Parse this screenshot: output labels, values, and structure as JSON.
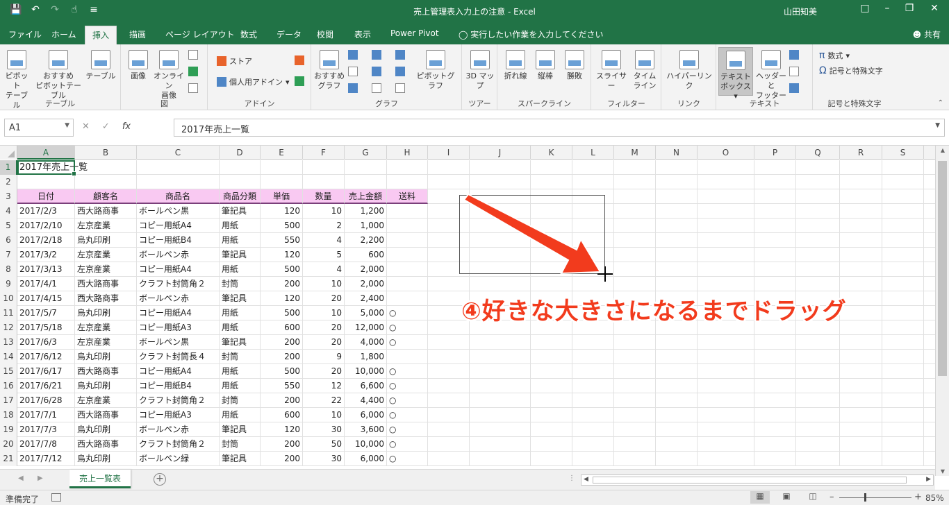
{
  "titlebar": {
    "doc_title": "売上管理表入力上の注意 - Excel",
    "user": "山田知美",
    "qat_icons": [
      "save-icon",
      "undo-icon",
      "redo-icon",
      "touch-mode-icon",
      "customize-icon"
    ]
  },
  "tabs": {
    "items": [
      "ファイル",
      "ホーム",
      "挿入",
      "描画",
      "ページ レイアウト",
      "数式",
      "データ",
      "校閲",
      "表示",
      "Power Pivot"
    ],
    "active": "挿入",
    "tell_me": "実行したい作業を入力してください",
    "share": "共有"
  },
  "ribbon": {
    "table_group": {
      "label": "テーブル",
      "pivot": "ピボット\nテーブル",
      "recommended_pivot": "おすすめ\nピボットテーブル",
      "table": "テーブル"
    },
    "illust_group": {
      "label": "図",
      "picture": "画像",
      "online_picture": "オンライン\n画像"
    },
    "addin_group": {
      "label": "アドイン",
      "store": "ストア",
      "my_addins": "個人用アドイン"
    },
    "chart_group": {
      "label": "グラフ",
      "recommended_chart": "おすすめ\nグラフ",
      "pivot_chart": "ピボットグラフ"
    },
    "tour_group": {
      "label": "ツアー",
      "map3d": "3D マッ\nプ"
    },
    "spark_group": {
      "label": "スパークライン",
      "line": "折れ線",
      "column": "縦棒",
      "winloss": "勝敗"
    },
    "filter_group": {
      "label": "フィルター",
      "slicer": "スライサー",
      "timeline": "タイム\nライン"
    },
    "link_group": {
      "label": "リンク",
      "hyperlink": "ハイパーリンク"
    },
    "text_group": {
      "label": "テキスト",
      "textbox": "テキスト\nボックス",
      "header_footer": "ヘッダーと\nフッター"
    },
    "symbol_group": {
      "label": "記号と特殊文字",
      "equation": "数式",
      "symbol": "記号と特殊文字"
    }
  },
  "formula_bar": {
    "name_box": "A1",
    "fx": "fx",
    "content": "2017年売上一覧"
  },
  "grid": {
    "columns": [
      "A",
      "B",
      "C",
      "D",
      "E",
      "F",
      "G",
      "H",
      "I",
      "J",
      "K",
      "L",
      "M",
      "N",
      "O",
      "P",
      "Q",
      "R",
      "S"
    ],
    "row_numbers": [
      "1",
      "2",
      "3",
      "4",
      "5",
      "6",
      "7",
      "8",
      "9",
      "10",
      "11",
      "12",
      "13",
      "14",
      "15",
      "16",
      "17",
      "18",
      "19",
      "20",
      "21"
    ],
    "title_cell": "2017年売上一覧",
    "headers": [
      "日付",
      "顧客名",
      "商品名",
      "商品分類",
      "単価",
      "数量",
      "売上金額",
      "送料"
    ],
    "rows": [
      [
        "2017/2/3",
        "西大路商事",
        "ボールペン黒",
        "筆記具",
        "120",
        "10",
        "1,200",
        ""
      ],
      [
        "2017/2/10",
        "左京産業",
        "コピー用紙A4",
        "用紙",
        "500",
        "2",
        "1,000",
        ""
      ],
      [
        "2017/2/18",
        "烏丸印刷",
        "コピー用紙B4",
        "用紙",
        "550",
        "4",
        "2,200",
        ""
      ],
      [
        "2017/3/2",
        "左京産業",
        "ボールペン赤",
        "筆記具",
        "120",
        "5",
        "600",
        ""
      ],
      [
        "2017/3/13",
        "左京産業",
        "コピー用紙A4",
        "用紙",
        "500",
        "4",
        "2,000",
        ""
      ],
      [
        "2017/4/1",
        "西大路商事",
        "クラフト封筒角２",
        "封筒",
        "200",
        "10",
        "2,000",
        ""
      ],
      [
        "2017/4/15",
        "西大路商事",
        "ボールペン赤",
        "筆記具",
        "120",
        "20",
        "2,400",
        ""
      ],
      [
        "2017/5/7",
        "烏丸印刷",
        "コピー用紙A4",
        "用紙",
        "500",
        "10",
        "5,000",
        "○"
      ],
      [
        "2017/5/18",
        "左京産業",
        "コピー用紙A3",
        "用紙",
        "600",
        "20",
        "12,000",
        "○"
      ],
      [
        "2017/6/3",
        "左京産業",
        "ボールペン黒",
        "筆記具",
        "200",
        "20",
        "4,000",
        "○"
      ],
      [
        "2017/6/12",
        "烏丸印刷",
        "クラフト封筒長４",
        "封筒",
        "200",
        "9",
        "1,800",
        ""
      ],
      [
        "2017/6/17",
        "西大路商事",
        "コピー用紙A4",
        "用紙",
        "500",
        "20",
        "10,000",
        "○"
      ],
      [
        "2017/6/21",
        "烏丸印刷",
        "コピー用紙B4",
        "用紙",
        "550",
        "12",
        "6,600",
        "○"
      ],
      [
        "2017/6/28",
        "左京産業",
        "クラフト封筒角２",
        "封筒",
        "200",
        "22",
        "4,400",
        "○"
      ],
      [
        "2017/7/1",
        "西大路商事",
        "コピー用紙A3",
        "用紙",
        "600",
        "10",
        "6,000",
        "○"
      ],
      [
        "2017/7/3",
        "烏丸印刷",
        "ボールペン赤",
        "筆記具",
        "120",
        "30",
        "3,600",
        "○"
      ],
      [
        "2017/7/8",
        "西大路商事",
        "クラフト封筒角２",
        "封筒",
        "200",
        "50",
        "10,000",
        "○"
      ],
      [
        "2017/7/12",
        "烏丸印刷",
        "ボールペン緑",
        "筆記具",
        "200",
        "30",
        "6,000",
        "○"
      ]
    ]
  },
  "annotation": "④好きな大きさになるまでドラッグ",
  "sheet_tab": "売上一覧表",
  "status": {
    "ready": "準備完了",
    "zoom": "85%"
  },
  "colors": {
    "excel_green": "#217346",
    "header_fill": "#f9c9f2",
    "annotation_red": "#f23b1d"
  }
}
